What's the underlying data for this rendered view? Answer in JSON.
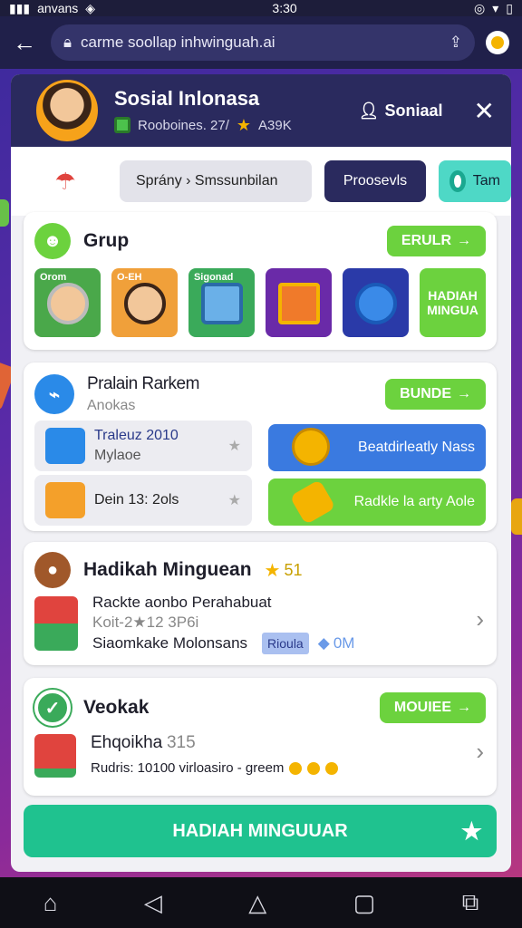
{
  "status": {
    "left_text": "anvans",
    "time": "3:30"
  },
  "browser": {
    "url": "carme soollap inhwinguah.ai"
  },
  "profile": {
    "name": "Sosial Inlonasa",
    "meta": "Rooboines. 27/",
    "points": "A39K",
    "tag": "Soniaal"
  },
  "tabs": [
    {
      "label": "Sprány › Smssunbilan"
    },
    {
      "label": "Proosevls"
    },
    {
      "label": "Tam"
    }
  ],
  "group_card": {
    "title": "Grup",
    "button": "ERULR",
    "thumbs": [
      {
        "label": "Orom"
      },
      {
        "label": "O-EH"
      },
      {
        "label": "Sigonad"
      },
      {
        "label": ""
      },
      {
        "label": ""
      },
      {
        "label": "HADIAH MINGUA"
      }
    ]
  },
  "rank_card": {
    "title": "Pralain Rarkem",
    "subtitle": "Anokas",
    "button": "BUNDE",
    "items": [
      {
        "line1": "Traleuz 2010",
        "line2": "Mylaoe"
      },
      {
        "line1": "Dein 13: 2ols"
      }
    ],
    "promo_blue": "Beatdirleatly Nass",
    "promo_green": "Radkle la arty Aole"
  },
  "weekly_card": {
    "title": "Hadikah Minguean",
    "star_count": "51",
    "line1": "Rackte aonbo Perahabuat",
    "line2": "Koit-2★12 3P6i",
    "line3": "Siaomkake Molonsans",
    "chip": "Rioula",
    "amount": "0M"
  },
  "watch_card": {
    "title": "Veokak",
    "button": "MOUIEE",
    "line1": "Ehqoikha",
    "line1b": "315",
    "line2": "Rudris: 10100 virloasiro - greem"
  },
  "cta": {
    "label": "HADIAH MINGUUAR"
  },
  "colors": {
    "accent_green": "#6cd23e",
    "brand_dark": "#2a2a5e",
    "cta_teal": "#1fc28f"
  }
}
